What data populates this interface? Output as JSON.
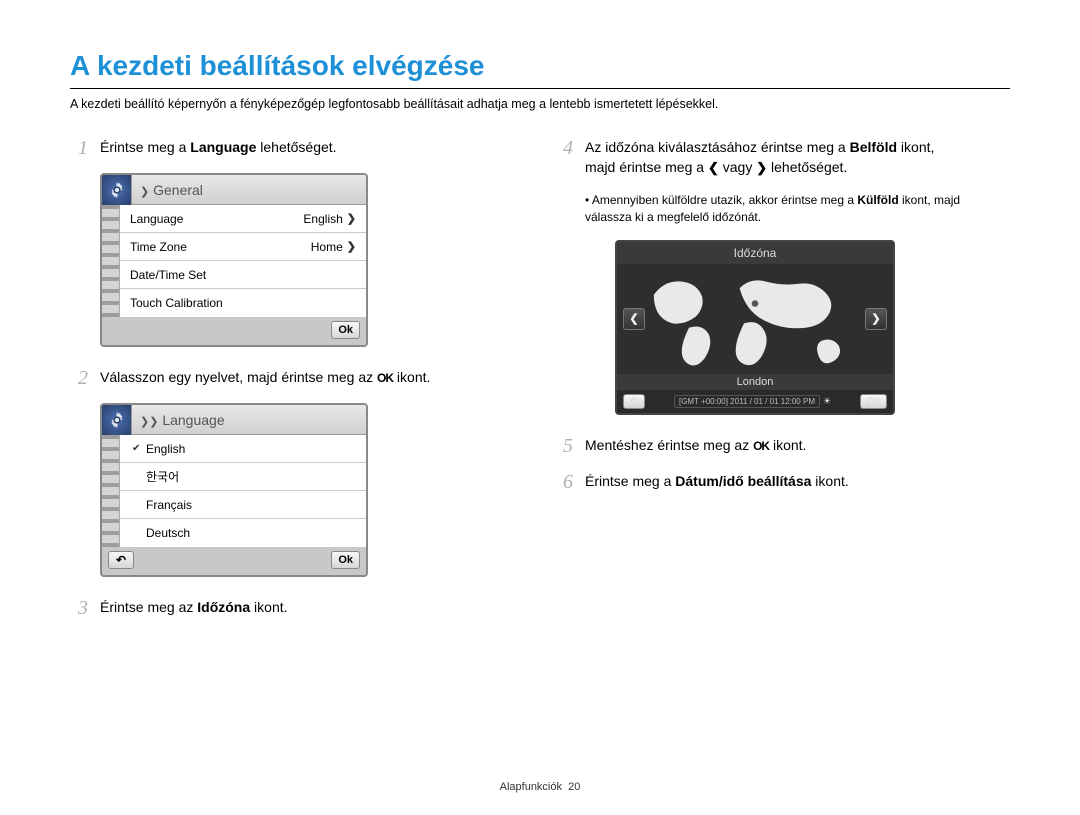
{
  "title": "A kezdeti beállítások elvégzése",
  "subtitle": "A kezdeti beállító képernyőn a fényképezőgép legfontosabb beállításait adhatja meg a lentebb ismertetett lépésekkel.",
  "steps": {
    "s1": {
      "num": "1",
      "prefix": "Érintse meg a ",
      "bold": "Language",
      "suffix": " lehetőséget."
    },
    "s2": {
      "num": "2",
      "prefix": "Válasszon egy nyelvet, majd érintse meg az ",
      "ok": "OK",
      "suffix": " ikont."
    },
    "s3": {
      "num": "3",
      "prefix": "Érintse meg az ",
      "bold": "Időzóna",
      "suffix": " ikont."
    },
    "s4": {
      "num": "4",
      "line1_prefix": "Az időzóna kiválasztásához érintse meg a ",
      "bold1": "Belföld",
      "line1_suffix": " ikont,",
      "line2_prefix": "majd érintse meg a ",
      "or": " vagy ",
      "line2_suffix": " lehetőséget."
    },
    "s4_note": {
      "prefix": "Amennyiben külföldre utazik, akkor érintse meg a ",
      "bold": "Külföld",
      "suffix": " ikont, majd válassza ki a megfelelő időzónát."
    },
    "s5": {
      "num": "5",
      "prefix": "Mentéshez érintse meg az ",
      "ok": "OK",
      "suffix": " ikont."
    },
    "s6": {
      "num": "6",
      "prefix": "Érintse meg a ",
      "bold": "Dátum/idő beállítása",
      "suffix": " ikont."
    }
  },
  "screen_general": {
    "header": "General",
    "rows": [
      {
        "label": "Language",
        "value": "English",
        "chev": true
      },
      {
        "label": "Time Zone",
        "value": "Home",
        "chev": true
      },
      {
        "label": "Date/Time Set",
        "value": "",
        "chev": false
      },
      {
        "label": "Touch Calibration",
        "value": "",
        "chev": false
      }
    ],
    "ok": "Ok"
  },
  "screen_language": {
    "header": "Language",
    "items": [
      {
        "label": "English",
        "checked": true
      },
      {
        "label": "한국어",
        "checked": false
      },
      {
        "label": "Français",
        "checked": false
      },
      {
        "label": "Deutsch",
        "checked": false
      }
    ],
    "back": "↶",
    "ok": "Ok"
  },
  "screen_timezone": {
    "title": "Időzóna",
    "city": "London",
    "info": "[GMT +00:00]  2011 / 01 / 01  12:00 PM",
    "back": "↶",
    "ok": "Ok"
  },
  "footer": {
    "section": "Alapfunkciók",
    "page": "20"
  }
}
